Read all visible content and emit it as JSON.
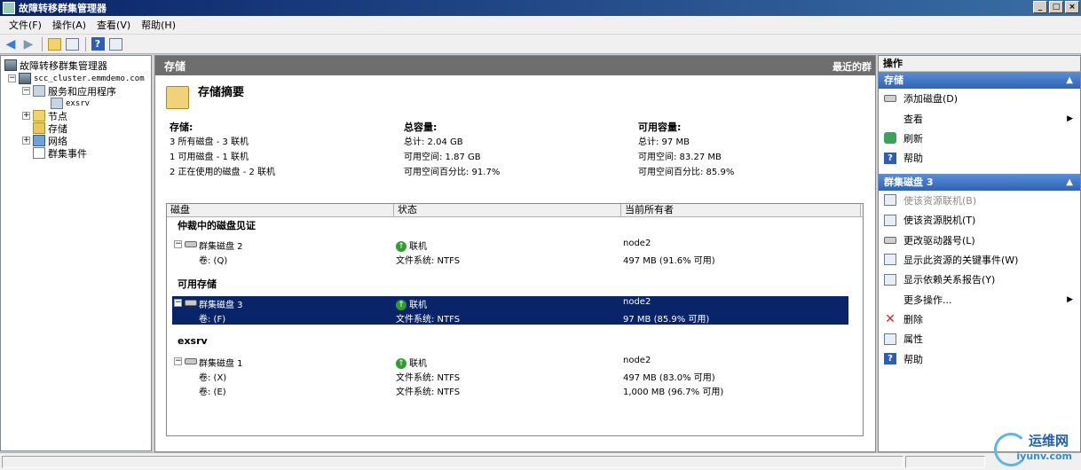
{
  "window": {
    "title": "故障转移群集管理器"
  },
  "menu": [
    "文件(F)",
    "操作(A)",
    "查看(V)",
    "帮助(H)"
  ],
  "tree": {
    "root": "故障转移群集管理器",
    "cluster": "scc_cluster.emmdemo.com",
    "services": "服务和应用程序",
    "exsrv": "exsrv",
    "nodes": "节点",
    "storage": "存储",
    "network": "网络",
    "events": "群集事件"
  },
  "center": {
    "header": "存储",
    "recent": "最近的群",
    "summary_title": "存储摘要",
    "storage": {
      "heading": "存储:",
      "lines": [
        "3 所有磁盘 - 3 联机",
        "1 可用磁盘 - 1 联机",
        "2 正在使用的磁盘 - 2 联机"
      ]
    },
    "total": {
      "heading": "总容量:",
      "lines": [
        "总计: 2.04 GB",
        "可用空间: 1.87 GB",
        "可用空间百分比: 91.7%"
      ]
    },
    "available": {
      "heading": "可用容量:",
      "lines": [
        "总计: 97 MB",
        "可用空间: 83.27 MB",
        "可用空间百分比: 85.9%"
      ]
    },
    "columns": [
      "磁盘",
      "状态",
      "当前所有者"
    ],
    "groups": {
      "witness": "仲裁中的磁盘见证",
      "available": "可用存储",
      "exsrv": "exsrv"
    },
    "disks": [
      {
        "name": "群集磁盘 2",
        "status": "联机",
        "owner": "node2",
        "vols": [
          {
            "vol": "卷: (Q)",
            "fs": "文件系统: NTFS",
            "size": "497 MB (91.6% 可用)"
          }
        ]
      },
      {
        "name": "群集磁盘 3",
        "status": "联机",
        "owner": "node2",
        "vols": [
          {
            "vol": "卷: (F)",
            "fs": "文件系统: NTFS",
            "size": "97 MB (85.9% 可用)"
          }
        ]
      },
      {
        "name": "群集磁盘 1",
        "status": "联机",
        "owner": "node2",
        "vols": [
          {
            "vol": "卷: (X)",
            "fs": "文件系统: NTFS",
            "size": "497 MB (83.0% 可用)"
          },
          {
            "vol": "卷: (E)",
            "fs": "文件系统: NTFS",
            "size": "1,000 MB (96.7% 可用)"
          }
        ]
      }
    ]
  },
  "actions": {
    "title": "操作",
    "section1": "存储",
    "s1_items": [
      "添加磁盘(D)",
      "查看",
      "刷新",
      "帮助"
    ],
    "section2": "群集磁盘 3",
    "s2_items": [
      "使该资源联机(B)",
      "使该资源脱机(T)",
      "更改驱动器号(L)",
      "显示此资源的关键事件(W)",
      "显示依赖关系报告(Y)",
      "更多操作...",
      "删除",
      "属性",
      "帮助"
    ]
  },
  "watermark": {
    "line1": "运维网",
    "line2": "iyunv.com"
  }
}
